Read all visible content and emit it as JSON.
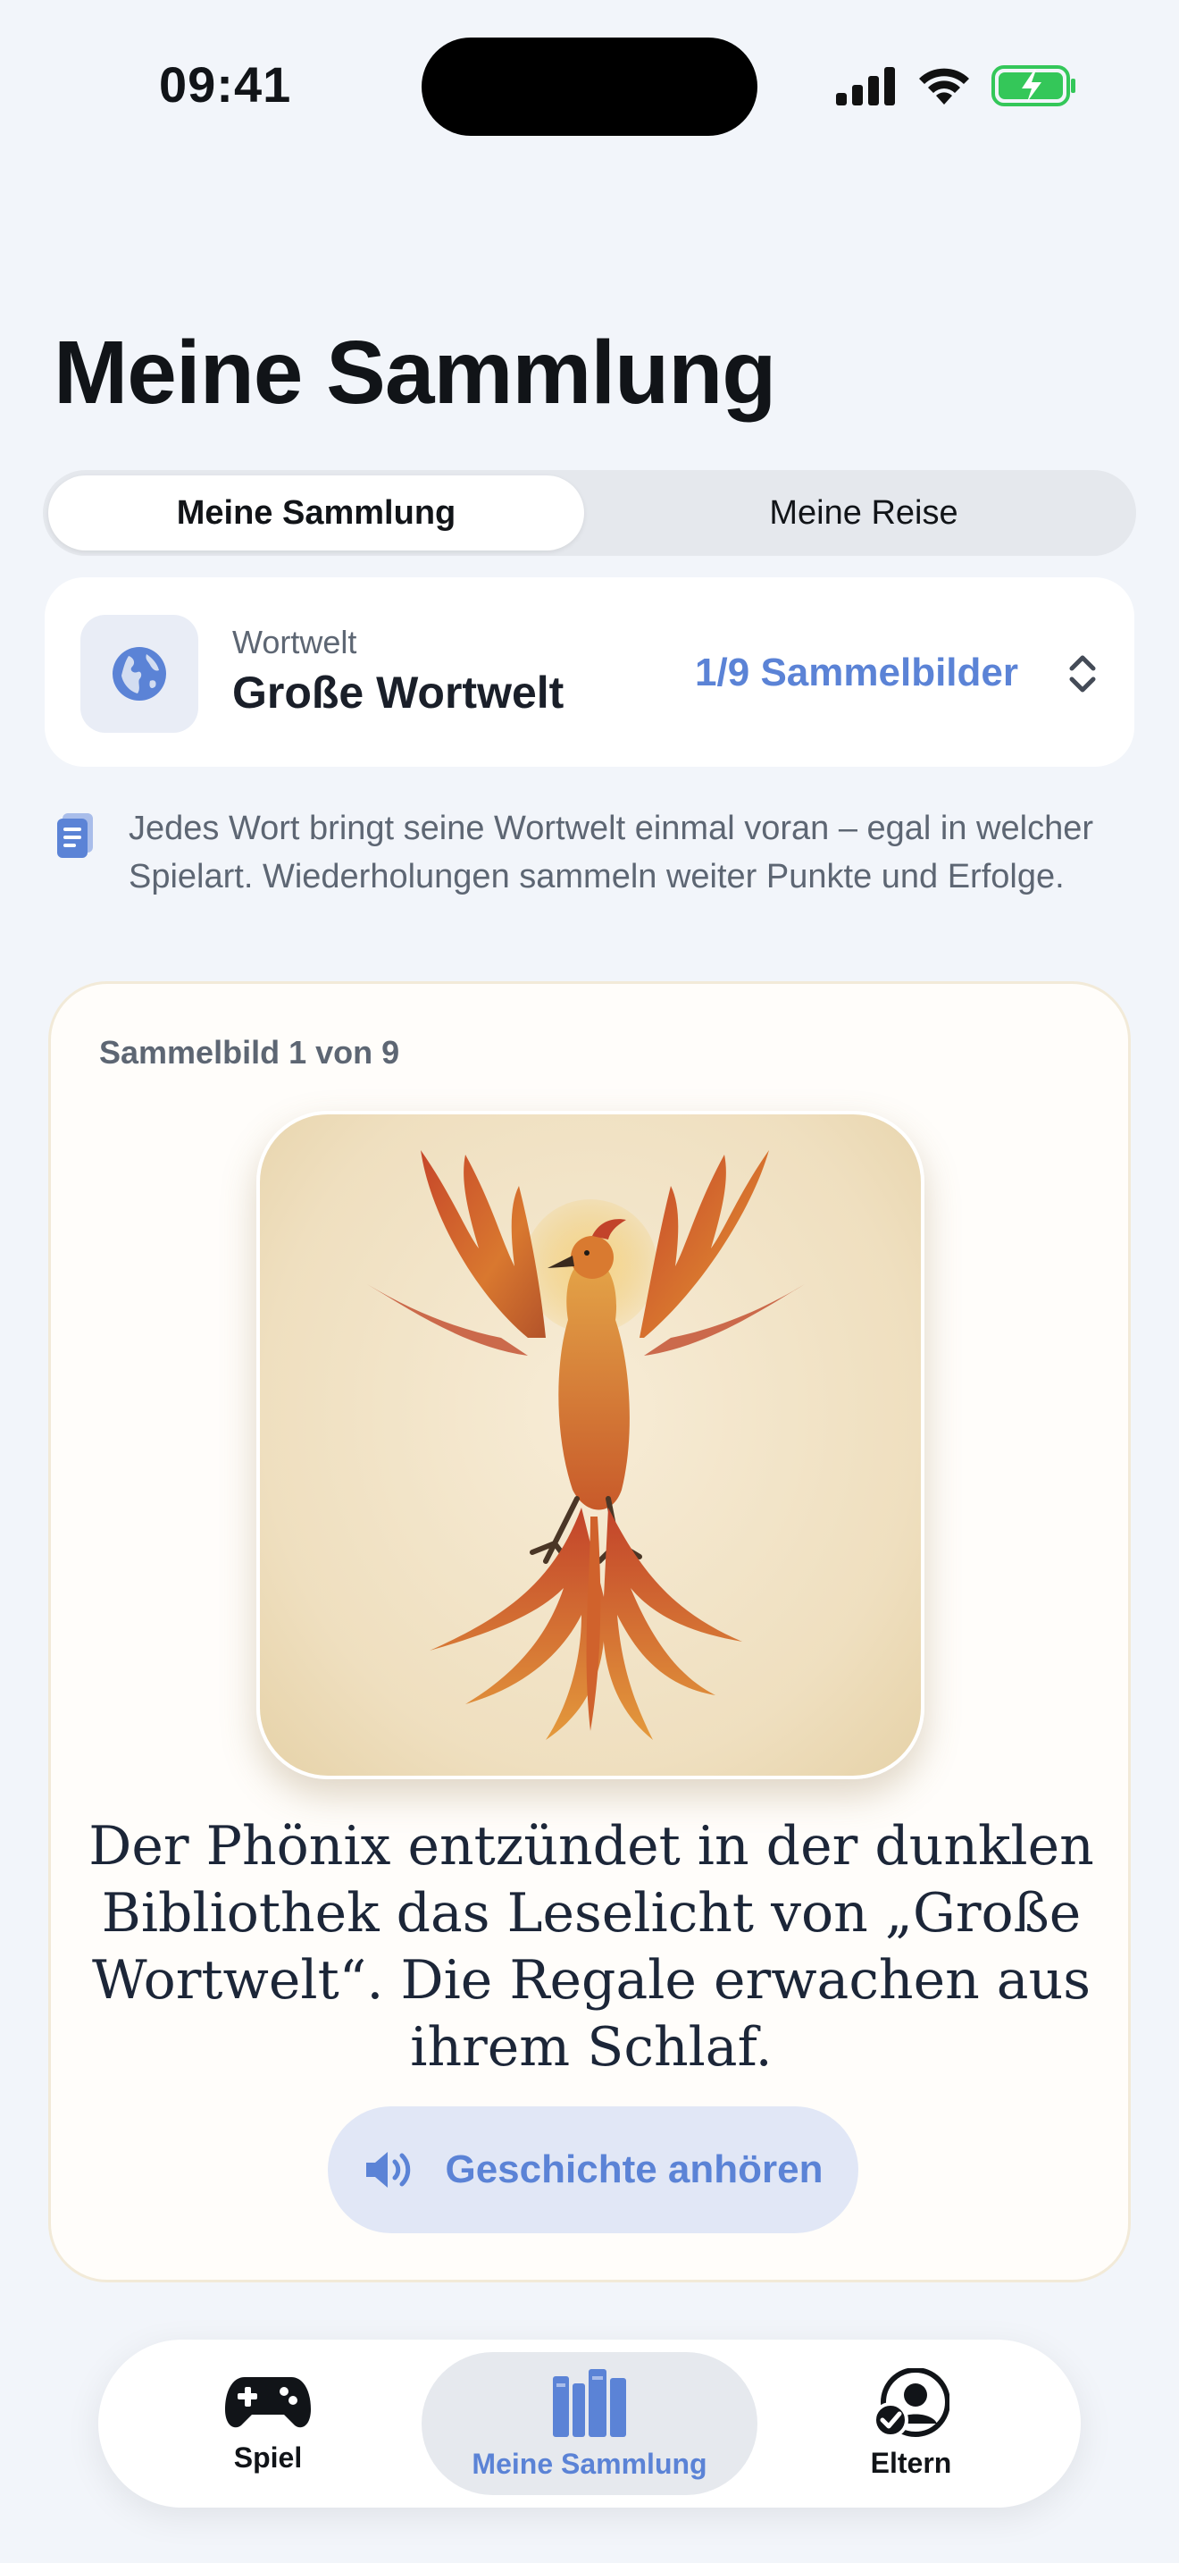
{
  "status": {
    "time": "09:41"
  },
  "page": {
    "title": "Meine Sammlung"
  },
  "segmented": {
    "active": "Meine Sammlung",
    "inactive": "Meine Reise"
  },
  "world": {
    "kicker": "Wortwelt",
    "name": "Große Wortwelt",
    "count": "1/9 Sammelbilder"
  },
  "info": {
    "text": "Jedes Wort bringt seine Wortwelt einmal voran – egal in welcher Spielart. Wiederholungen sammeln weiter Punkte und Erfolge."
  },
  "collectible": {
    "kicker": "Sammelbild 1 von 9",
    "story": "Der Phönix entzündet in der dunklen Bibliothek das Leselicht von „Große Wortwelt“. Die Regale erwachen aus ihrem Schlaf.",
    "listen_label": "Geschichte anhören"
  },
  "tabs": [
    {
      "label": "Spiel",
      "icon": "gamepad-icon"
    },
    {
      "label": "Meine Sammlung",
      "icon": "books-icon"
    },
    {
      "label": "Eltern",
      "icon": "parent-check-icon"
    }
  ],
  "colors": {
    "accent": "#5b83d6",
    "background": "#f2f5fa",
    "card": "#ffffff",
    "battery": "#34c759"
  }
}
